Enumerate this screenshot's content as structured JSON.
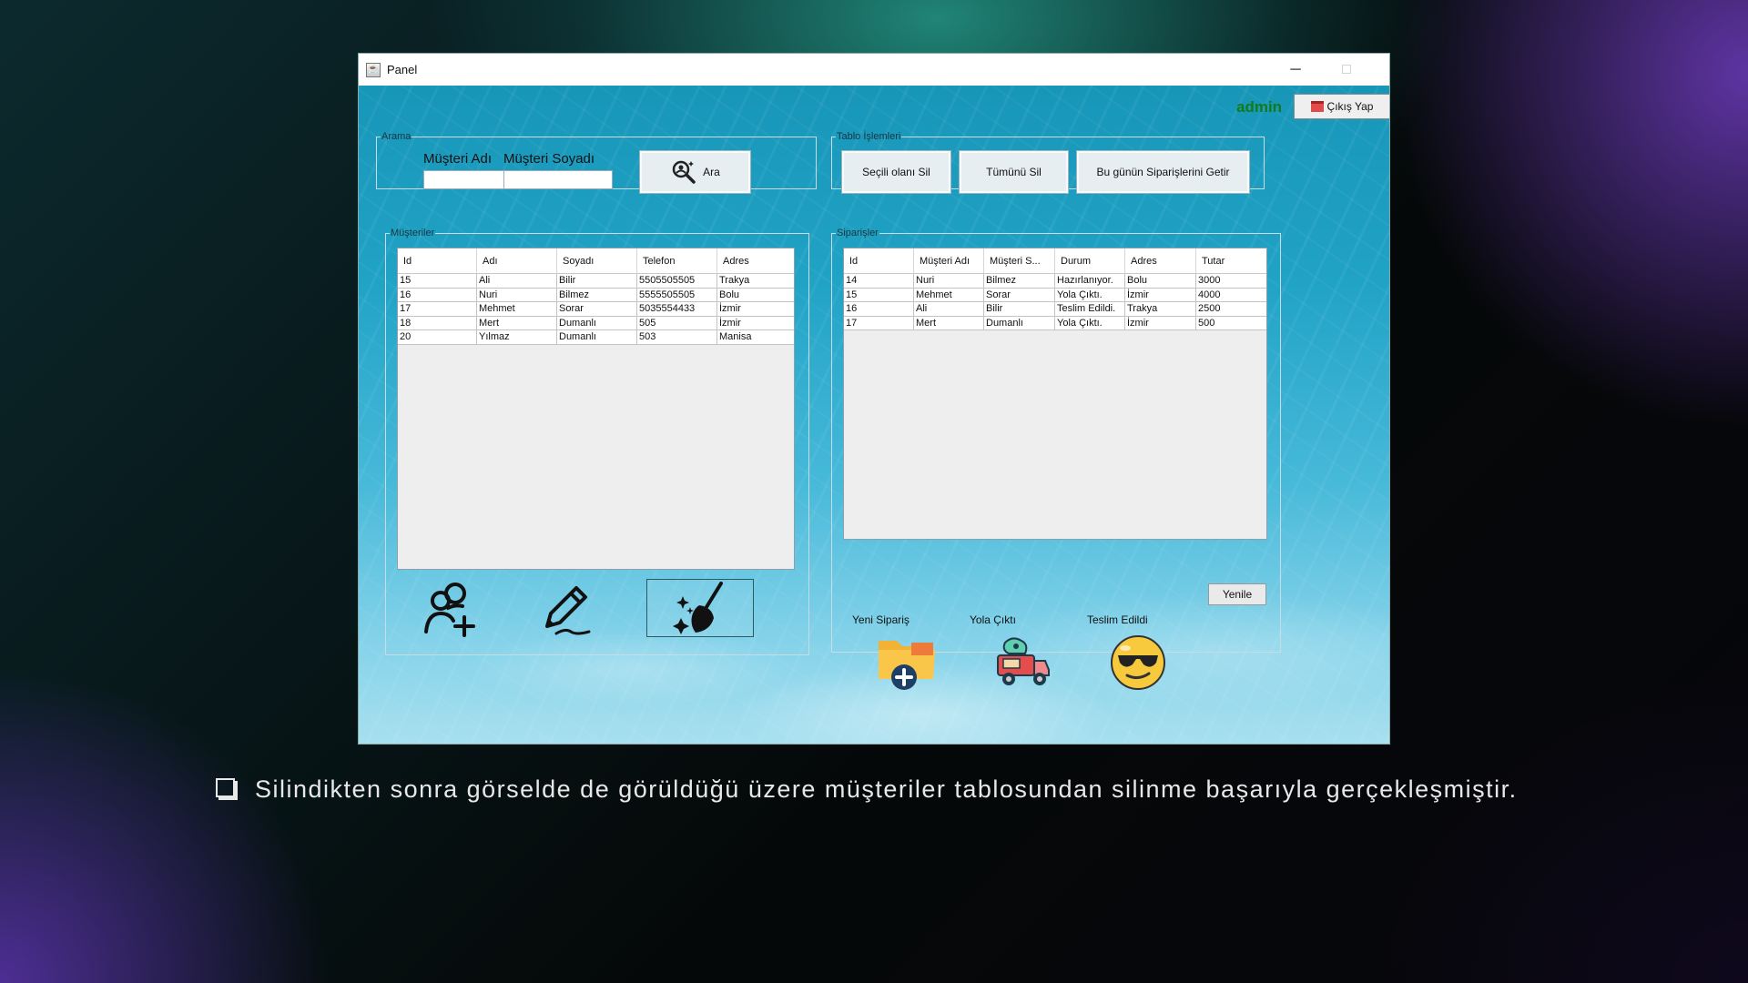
{
  "window": {
    "title": "Panel",
    "controls": {
      "minimize": "─",
      "maximize": "□",
      "close": "✕"
    }
  },
  "header": {
    "user": "admin",
    "logout_label": "Çıkış Yap"
  },
  "search": {
    "legend": "Arama",
    "first_name_label": "Müşteri Adı",
    "last_name_label": "Müşteri Soyadı",
    "first_name_value": "",
    "last_name_value": "",
    "button_label": "Ara"
  },
  "table_ops": {
    "legend": "Tablo İşlemleri",
    "delete_selected": "Seçili olanı Sil",
    "delete_all": "Tümünü Sil",
    "todays_orders": "Bu günün Siparişlerini Getir"
  },
  "customers": {
    "legend": "Müşteriler",
    "columns": [
      "Id",
      "Adı",
      "Soyadı",
      "Telefon",
      "Adres"
    ],
    "rows": [
      [
        "15",
        "Ali",
        "Bilir",
        "5505505505",
        "Trakya"
      ],
      [
        "16",
        "Nuri",
        "Bilmez",
        "5555505505",
        "Bolu"
      ],
      [
        "17",
        "Mehmet",
        "Sorar",
        "5035554433",
        "İzmir"
      ],
      [
        "18",
        "Mert",
        "Dumanlı",
        "505",
        "İzmir"
      ],
      [
        "20",
        "Yılmaz",
        "Dumanlı",
        "503",
        "Manisa"
      ]
    ]
  },
  "orders": {
    "legend": "Siparişler",
    "columns": [
      "Id",
      "Müşteri Adı",
      "Müşteri S...",
      "Durum",
      "Adres",
      "Tutar"
    ],
    "rows": [
      [
        "14",
        "Nuri",
        "Bilmez",
        "Hazırlanıyor.",
        "Bolu",
        "3000"
      ],
      [
        "15",
        "Mehmet",
        "Sorar",
        "Yola Çıktı.",
        "İzmir",
        "4000"
      ],
      [
        "16",
        "Ali",
        "Bilir",
        "Teslim Edildi.",
        "Trakya",
        "2500"
      ],
      [
        "17",
        "Mert",
        "Dumanlı",
        "Yola Çıktı.",
        "İzmir",
        "500"
      ]
    ],
    "status_new": "Yeni Sipariş",
    "status_shipped": "Yola Çıktı",
    "status_delivered": "Teslim Edildi",
    "refresh_label": "Yenile"
  },
  "icons": {
    "add_customer": "add-user-icon",
    "edit_customer": "pencil-icon",
    "clean": "broom-sparkle-icon",
    "new_order": "folder-plus-icon",
    "shipped": "delivery-truck-icon",
    "delivered": "sunglasses-smiley-icon"
  },
  "caption": {
    "text": "Silindikten sonra görselde de görüldüğü üzere müşteriler tablosundan silinme başarıyla gerçekleşmiştir."
  },
  "colors": {
    "admin": "#137a1a",
    "background_water": "#21a3c6"
  }
}
